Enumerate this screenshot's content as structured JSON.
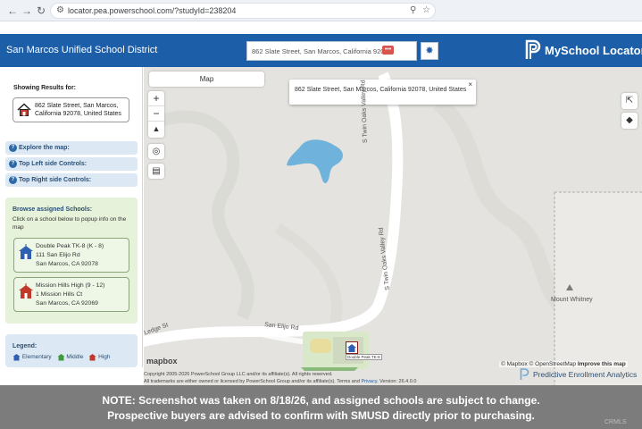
{
  "browser": {
    "url": "locator.pea.powerschool.com/?studyId=238204",
    "icons": [
      "back-icon",
      "forward-icon",
      "reload-icon",
      "site-info-icon",
      "zoom-icon",
      "bookmark-star-icon"
    ]
  },
  "header": {
    "district": "San Marcos Unified School District",
    "search_value": "862 Slate Street, San Marcos, California 92078",
    "brand": "MySchool Locator",
    "colors": {
      "header_bg": "#1d5ea8"
    }
  },
  "sidebar": {
    "showing_label": "Showing Results for:",
    "address": "862 Slate Street, San Marcos, California 92078, United States",
    "help_rows": [
      {
        "label": "Explore the map:"
      },
      {
        "label": "Top Left side Controls:"
      },
      {
        "label": "Top Right side Controls:"
      }
    ],
    "browse_title": "Browse assigned Schools:",
    "browse_desc": "Click on a school below to popup info on the map",
    "schools": [
      {
        "name": "Double Peak TK-8 (K - 8)",
        "street": "111 San Elijo Rd",
        "city": "San Marcos, CA 92078",
        "level": "Elementary"
      },
      {
        "name": "Mission Hills High (9 - 12)",
        "street": "1 Mission Hills Ct",
        "city": "San Marcos, CA 92069",
        "level": "High"
      }
    ],
    "legend_title": "Legend:",
    "legend": [
      {
        "label": "Elementary",
        "color": "#2d5fb3"
      },
      {
        "label": "Middle",
        "color": "#3f9a3a"
      },
      {
        "label": "High",
        "color": "#c0392b"
      }
    ]
  },
  "map": {
    "tab": "Map",
    "popup": "862 Slate Street, San Marcos, California 92078, United States",
    "roads": {
      "twin_oaks_upper": "S Twin Oaks Valley Rd",
      "twin_oaks_lower": "S Twin Oaks Valley Rd",
      "san_elijo": "San Elijo Rd",
      "ledge": "Ledge St"
    },
    "peak": "Mount Whitney",
    "school_marker_label": "Double Peak TK-8",
    "logo": "mapbox",
    "attribution": {
      "mapbox": "© Mapbox",
      "osm": "© OpenStreetMap",
      "improve": "Improve this map"
    },
    "copyright_1": "Copyright 2005-2026 PowerSchool Group LLC and/or its affiliate(s). All rights reserved.",
    "copyright_2": "All trademarks are either owned or licensed by PowerSchool Group and/or its affiliate(s). Terms and",
    "privacy": "Privacy",
    "version": ". Version: 26.4.0.0",
    "pea_brand": "Predictive Enrollment Analytics"
  },
  "notice": {
    "line1": "NOTE: Screenshot was taken on 8/18/26, and assigned schools are subject to change.",
    "line2": "Prospective buyers are advised to confirm with SMUSD directly prior to purchasing."
  },
  "watermark": "CRMLS"
}
